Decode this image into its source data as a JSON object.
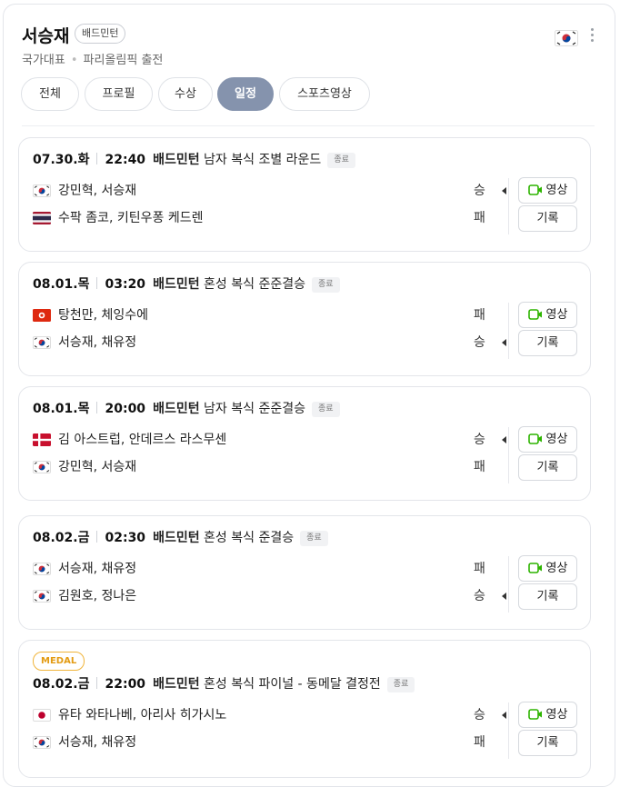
{
  "header": {
    "name": "서승재",
    "sport_badge": "배드민턴",
    "sub_team": "국가대표",
    "sub_event": "파리올림픽 출전"
  },
  "tabs": [
    {
      "label": "전체"
    },
    {
      "label": "프로필"
    },
    {
      "label": "수상"
    },
    {
      "label": "일정",
      "active": true
    },
    {
      "label": "스포츠영상"
    }
  ],
  "buttons": {
    "video": "영상",
    "record": "기록"
  },
  "colors": {
    "active_tab": "#8593ad",
    "video_icon": "#2db400",
    "medal": "#f0b43a"
  },
  "matches": [
    {
      "date": "07.30.화",
      "time": "22:40",
      "sport": "배드민턴",
      "event": "남자 복식 조별 라운드",
      "status": "종료",
      "teams": [
        {
          "flag": "korea-flag-icon",
          "players": "강민혁, 서승재",
          "result": "승",
          "winner": true
        },
        {
          "flag": "thailand-flag-icon",
          "players": "수팍 좀코, 키틴우퐁 케드렌",
          "result": "패",
          "winner": false
        }
      ]
    },
    {
      "date": "08.01.목",
      "time": "03:20",
      "sport": "배드민턴",
      "event": "혼성 복식 준준결승",
      "status": "종료",
      "teams": [
        {
          "flag": "hongkong-flag-icon",
          "players": "탕천만, 체잉수에",
          "result": "패",
          "winner": false
        },
        {
          "flag": "korea-flag-icon",
          "players": "서승재, 채유정",
          "result": "승",
          "winner": true
        }
      ]
    },
    {
      "date": "08.01.목",
      "time": "20:00",
      "sport": "배드민턴",
      "event": "남자 복식 준준결승",
      "status": "종료",
      "teams": [
        {
          "flag": "denmark-flag-icon",
          "players": "김 아스트럽, 안데르스 라스무센",
          "result": "승",
          "winner": true
        },
        {
          "flag": "korea-flag-icon",
          "players": "강민혁, 서승재",
          "result": "패",
          "winner": false
        }
      ]
    },
    {
      "date": "08.02.금",
      "time": "02:30",
      "sport": "배드민턴",
      "event": "혼성 복식 준결승",
      "status": "종료",
      "teams": [
        {
          "flag": "korea-flag-icon",
          "players": "서승재, 채유정",
          "result": "패",
          "winner": false
        },
        {
          "flag": "korea-flag-icon",
          "players": "김원호, 정나은",
          "result": "승",
          "winner": true
        }
      ]
    },
    {
      "medal": "MEDAL",
      "date": "08.02.금",
      "time": "22:00",
      "sport": "배드민턴",
      "event": "혼성 복식 파이널 - 동메달 결정전",
      "status": "종료",
      "teams": [
        {
          "flag": "japan-flag-icon",
          "players": "유타 와타나베, 아리사 히가시노",
          "result": "승",
          "winner": true
        },
        {
          "flag": "korea-flag-icon",
          "players": "서승재, 채유정",
          "result": "패",
          "winner": false
        }
      ]
    }
  ]
}
